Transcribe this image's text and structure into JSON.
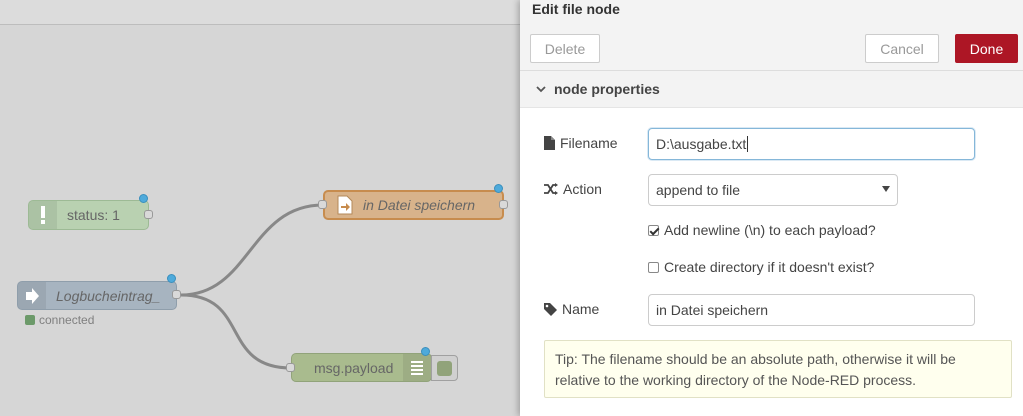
{
  "workspace": {
    "nodes": {
      "status": {
        "label": "status: 1"
      },
      "link": {
        "label": "Logbucheintrag_",
        "status_text": "connected"
      },
      "file": {
        "label": "in Datei speichern"
      },
      "debug": {
        "label": "msg.payload"
      }
    }
  },
  "editor": {
    "title": "Edit file node",
    "buttons": {
      "delete": "Delete",
      "cancel": "Cancel",
      "done": "Done"
    },
    "section_title": "node properties",
    "filename": {
      "label": "Filename",
      "value": "D:\\ausgabe.txt"
    },
    "action": {
      "label": "Action",
      "selected": "append to file"
    },
    "add_newline": {
      "label": "Add newline (\\n) to each payload?",
      "checked": true
    },
    "create_dir": {
      "label": "Create directory if it doesn't exist?",
      "checked": false
    },
    "name": {
      "label": "Name",
      "value": "in Datei speichern"
    },
    "tip": "Tip: The filename should be an absolute path, otherwise it will be relative to the working directory of the Node-RED process."
  },
  "colors": {
    "done_button": "#ad1625",
    "file_node": "#d8b38b",
    "status_node": "#b9d1b1",
    "link_node": "#a7b4c0",
    "debug_node": "#a9bb8e",
    "changed_dot": "#4eaadb",
    "tip_background": "#ffffee"
  },
  "icons": [
    "alert-icon",
    "link-in-icon",
    "file-icon",
    "list-icon",
    "file-text-icon",
    "shuffle-icon",
    "tag-icon",
    "chevron-down-icon"
  ]
}
